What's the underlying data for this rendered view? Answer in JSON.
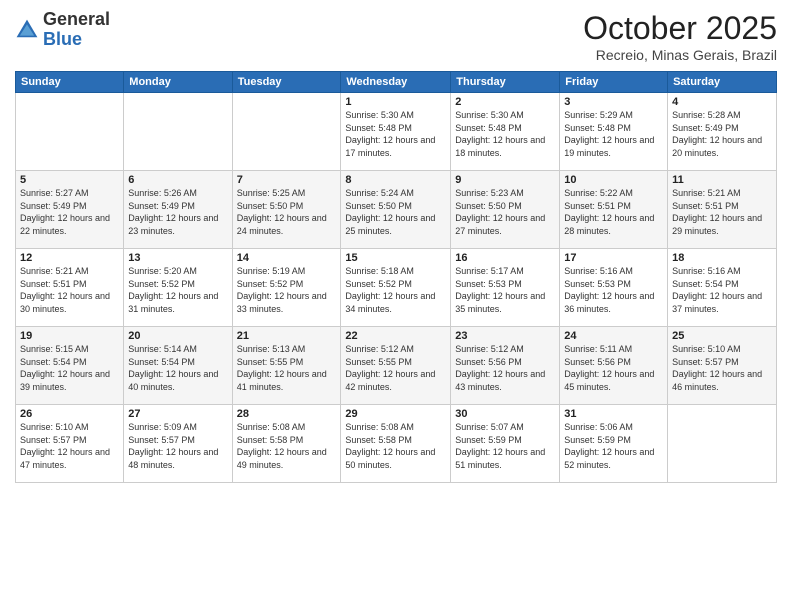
{
  "header": {
    "logo_line1": "General",
    "logo_line2": "Blue",
    "month": "October 2025",
    "location": "Recreio, Minas Gerais, Brazil"
  },
  "weekdays": [
    "Sunday",
    "Monday",
    "Tuesday",
    "Wednesday",
    "Thursday",
    "Friday",
    "Saturday"
  ],
  "weeks": [
    [
      {
        "day": "",
        "sunrise": "",
        "sunset": "",
        "daylight": ""
      },
      {
        "day": "",
        "sunrise": "",
        "sunset": "",
        "daylight": ""
      },
      {
        "day": "",
        "sunrise": "",
        "sunset": "",
        "daylight": ""
      },
      {
        "day": "1",
        "sunrise": "Sunrise: 5:30 AM",
        "sunset": "Sunset: 5:48 PM",
        "daylight": "Daylight: 12 hours and 17 minutes."
      },
      {
        "day": "2",
        "sunrise": "Sunrise: 5:30 AM",
        "sunset": "Sunset: 5:48 PM",
        "daylight": "Daylight: 12 hours and 18 minutes."
      },
      {
        "day": "3",
        "sunrise": "Sunrise: 5:29 AM",
        "sunset": "Sunset: 5:48 PM",
        "daylight": "Daylight: 12 hours and 19 minutes."
      },
      {
        "day": "4",
        "sunrise": "Sunrise: 5:28 AM",
        "sunset": "Sunset: 5:49 PM",
        "daylight": "Daylight: 12 hours and 20 minutes."
      }
    ],
    [
      {
        "day": "5",
        "sunrise": "Sunrise: 5:27 AM",
        "sunset": "Sunset: 5:49 PM",
        "daylight": "Daylight: 12 hours and 22 minutes."
      },
      {
        "day": "6",
        "sunrise": "Sunrise: 5:26 AM",
        "sunset": "Sunset: 5:49 PM",
        "daylight": "Daylight: 12 hours and 23 minutes."
      },
      {
        "day": "7",
        "sunrise": "Sunrise: 5:25 AM",
        "sunset": "Sunset: 5:50 PM",
        "daylight": "Daylight: 12 hours and 24 minutes."
      },
      {
        "day": "8",
        "sunrise": "Sunrise: 5:24 AM",
        "sunset": "Sunset: 5:50 PM",
        "daylight": "Daylight: 12 hours and 25 minutes."
      },
      {
        "day": "9",
        "sunrise": "Sunrise: 5:23 AM",
        "sunset": "Sunset: 5:50 PM",
        "daylight": "Daylight: 12 hours and 27 minutes."
      },
      {
        "day": "10",
        "sunrise": "Sunrise: 5:22 AM",
        "sunset": "Sunset: 5:51 PM",
        "daylight": "Daylight: 12 hours and 28 minutes."
      },
      {
        "day": "11",
        "sunrise": "Sunrise: 5:21 AM",
        "sunset": "Sunset: 5:51 PM",
        "daylight": "Daylight: 12 hours and 29 minutes."
      }
    ],
    [
      {
        "day": "12",
        "sunrise": "Sunrise: 5:21 AM",
        "sunset": "Sunset: 5:51 PM",
        "daylight": "Daylight: 12 hours and 30 minutes."
      },
      {
        "day": "13",
        "sunrise": "Sunrise: 5:20 AM",
        "sunset": "Sunset: 5:52 PM",
        "daylight": "Daylight: 12 hours and 31 minutes."
      },
      {
        "day": "14",
        "sunrise": "Sunrise: 5:19 AM",
        "sunset": "Sunset: 5:52 PM",
        "daylight": "Daylight: 12 hours and 33 minutes."
      },
      {
        "day": "15",
        "sunrise": "Sunrise: 5:18 AM",
        "sunset": "Sunset: 5:52 PM",
        "daylight": "Daylight: 12 hours and 34 minutes."
      },
      {
        "day": "16",
        "sunrise": "Sunrise: 5:17 AM",
        "sunset": "Sunset: 5:53 PM",
        "daylight": "Daylight: 12 hours and 35 minutes."
      },
      {
        "day": "17",
        "sunrise": "Sunrise: 5:16 AM",
        "sunset": "Sunset: 5:53 PM",
        "daylight": "Daylight: 12 hours and 36 minutes."
      },
      {
        "day": "18",
        "sunrise": "Sunrise: 5:16 AM",
        "sunset": "Sunset: 5:54 PM",
        "daylight": "Daylight: 12 hours and 37 minutes."
      }
    ],
    [
      {
        "day": "19",
        "sunrise": "Sunrise: 5:15 AM",
        "sunset": "Sunset: 5:54 PM",
        "daylight": "Daylight: 12 hours and 39 minutes."
      },
      {
        "day": "20",
        "sunrise": "Sunrise: 5:14 AM",
        "sunset": "Sunset: 5:54 PM",
        "daylight": "Daylight: 12 hours and 40 minutes."
      },
      {
        "day": "21",
        "sunrise": "Sunrise: 5:13 AM",
        "sunset": "Sunset: 5:55 PM",
        "daylight": "Daylight: 12 hours and 41 minutes."
      },
      {
        "day": "22",
        "sunrise": "Sunrise: 5:12 AM",
        "sunset": "Sunset: 5:55 PM",
        "daylight": "Daylight: 12 hours and 42 minutes."
      },
      {
        "day": "23",
        "sunrise": "Sunrise: 5:12 AM",
        "sunset": "Sunset: 5:56 PM",
        "daylight": "Daylight: 12 hours and 43 minutes."
      },
      {
        "day": "24",
        "sunrise": "Sunrise: 5:11 AM",
        "sunset": "Sunset: 5:56 PM",
        "daylight": "Daylight: 12 hours and 45 minutes."
      },
      {
        "day": "25",
        "sunrise": "Sunrise: 5:10 AM",
        "sunset": "Sunset: 5:57 PM",
        "daylight": "Daylight: 12 hours and 46 minutes."
      }
    ],
    [
      {
        "day": "26",
        "sunrise": "Sunrise: 5:10 AM",
        "sunset": "Sunset: 5:57 PM",
        "daylight": "Daylight: 12 hours and 47 minutes."
      },
      {
        "day": "27",
        "sunrise": "Sunrise: 5:09 AM",
        "sunset": "Sunset: 5:57 PM",
        "daylight": "Daylight: 12 hours and 48 minutes."
      },
      {
        "day": "28",
        "sunrise": "Sunrise: 5:08 AM",
        "sunset": "Sunset: 5:58 PM",
        "daylight": "Daylight: 12 hours and 49 minutes."
      },
      {
        "day": "29",
        "sunrise": "Sunrise: 5:08 AM",
        "sunset": "Sunset: 5:58 PM",
        "daylight": "Daylight: 12 hours and 50 minutes."
      },
      {
        "day": "30",
        "sunrise": "Sunrise: 5:07 AM",
        "sunset": "Sunset: 5:59 PM",
        "daylight": "Daylight: 12 hours and 51 minutes."
      },
      {
        "day": "31",
        "sunrise": "Sunrise: 5:06 AM",
        "sunset": "Sunset: 5:59 PM",
        "daylight": "Daylight: 12 hours and 52 minutes."
      },
      {
        "day": "",
        "sunrise": "",
        "sunset": "",
        "daylight": ""
      }
    ]
  ]
}
